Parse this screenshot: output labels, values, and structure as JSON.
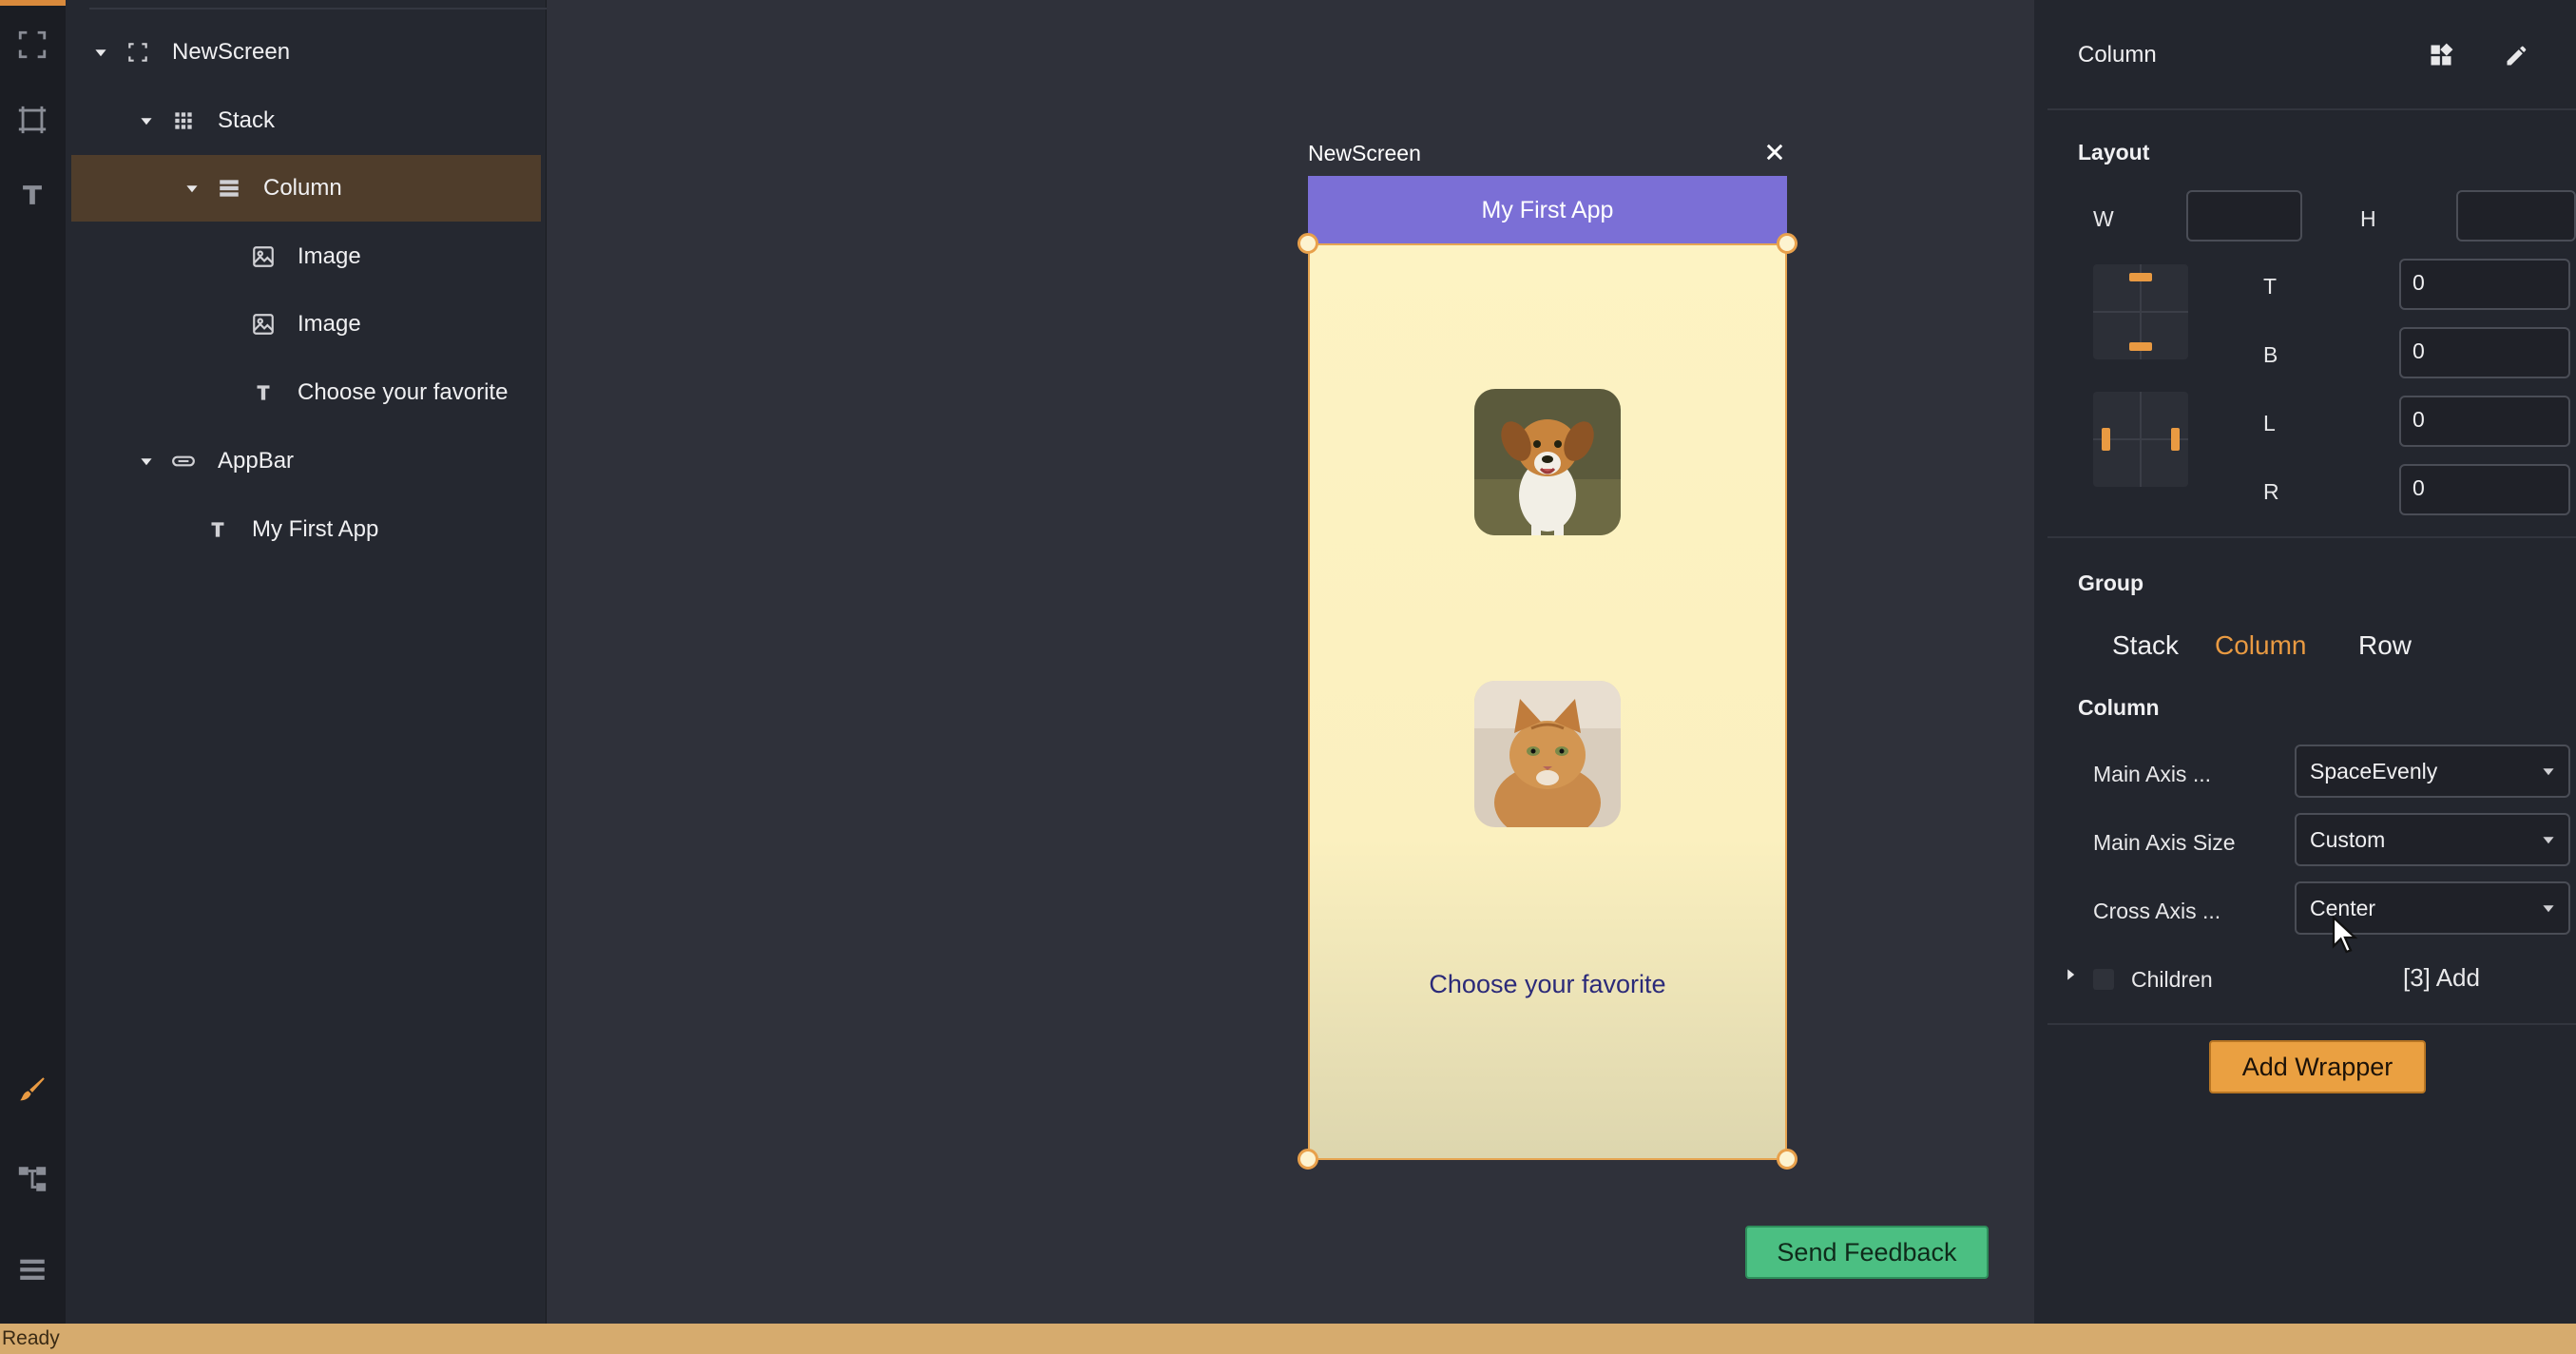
{
  "tree": {
    "nodes": [
      {
        "label": "NewScreen",
        "icon": "fullscreen-icon"
      },
      {
        "label": "Stack",
        "icon": "grid-icon"
      },
      {
        "label": "Column",
        "icon": "column-icon"
      },
      {
        "label": "Image",
        "icon": "image-icon"
      },
      {
        "label": "Image",
        "icon": "image-icon"
      },
      {
        "label": "Choose your favorite",
        "icon": "text-icon"
      },
      {
        "label": "AppBar",
        "icon": "appbar-icon"
      },
      {
        "label": "My First App",
        "icon": "text-icon"
      }
    ]
  },
  "canvas": {
    "screen_title": "NewScreen",
    "appbar_title": "My First App",
    "choose_text": "Choose your favorite",
    "images": [
      "dog-photo",
      "cat-photo"
    ],
    "feedback_label": "Send Feedback"
  },
  "props": {
    "header_title": "Column",
    "layout": {
      "title": "Layout",
      "w_label": "W",
      "h_label": "H",
      "w_value": "",
      "h_value": "",
      "t_label": "T",
      "t_value": "0",
      "b_label": "B",
      "b_value": "0",
      "l_label": "L",
      "l_value": "0",
      "r_label": "R",
      "r_value": "0"
    },
    "group": {
      "title": "Group",
      "options": [
        "Stack",
        "Column",
        "Row"
      ],
      "selected": "Column"
    },
    "column": {
      "title": "Column",
      "main_axis_label": "Main Axis ...",
      "main_axis_value": "SpaceEvenly",
      "main_size_label": "Main Axis Size",
      "main_size_value": "Custom",
      "cross_axis_label": "Cross Axis ...",
      "cross_axis_value": "Center"
    },
    "children_label": "Children",
    "children_add": "[3] Add",
    "add_wrapper_label": "Add Wrapper"
  },
  "status": {
    "text": "Ready"
  },
  "colors": {
    "accent": "#e99a42",
    "appbar": "#7b6fd6",
    "feedback": "#4bbf82",
    "selection": "#4f3d2b"
  }
}
